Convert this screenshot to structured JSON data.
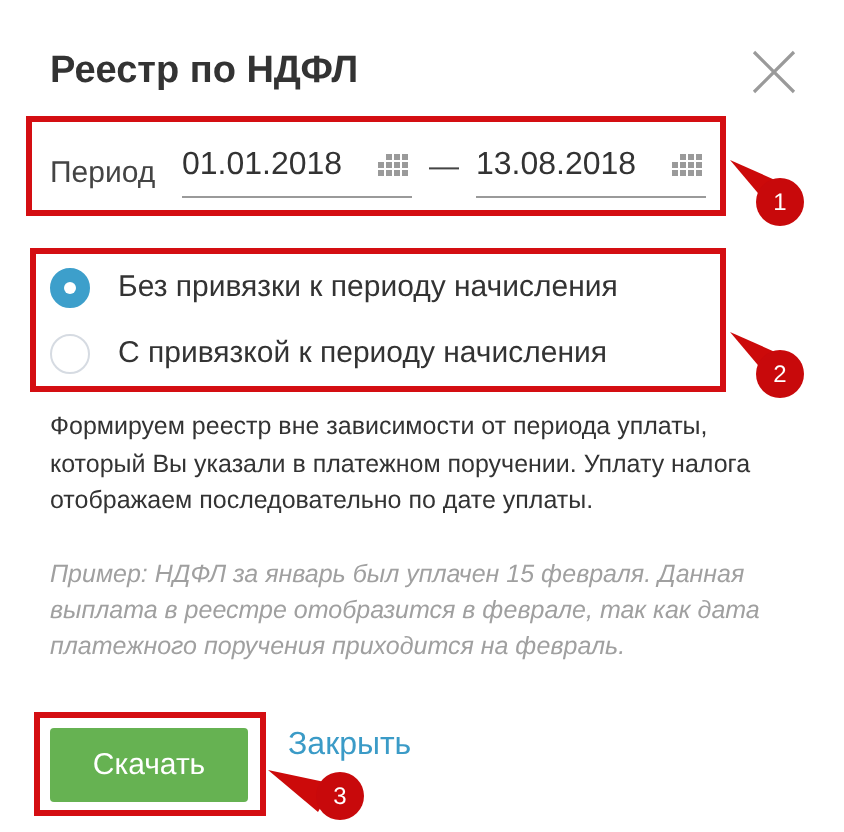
{
  "dialog": {
    "title": "Реестр по НДФЛ"
  },
  "period": {
    "label": "Период",
    "from": "01.01.2018",
    "separator": "—",
    "to": "13.08.2018"
  },
  "options": [
    {
      "label": "Без привязки к периоду начисления",
      "selected": true
    },
    {
      "label": "С привязкой к периоду начисления",
      "selected": false
    }
  ],
  "description": "Формируем реестр вне зависимости от периода уплаты, который Вы указали в платежном поручении. Уплату налога отображаем последовательно по дате уплаты.",
  "example": "Пример: НДФЛ за январь был уплачен 15 февраля. Данная выплата в реестре отобразится в феврале, так как дата платежного поручения приходится на февраль.",
  "buttons": {
    "download": "Скачать",
    "close": "Закрыть"
  },
  "callouts": [
    "1",
    "2",
    "3"
  ]
}
